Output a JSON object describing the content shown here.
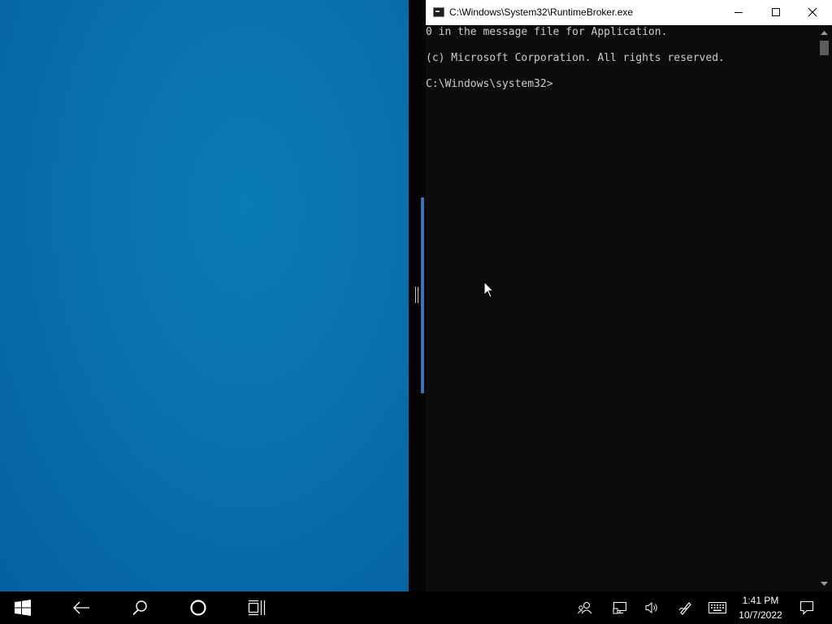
{
  "console": {
    "title": "C:\\Windows\\System32\\RuntimeBroker.exe",
    "icon": "cmd-console-icon",
    "lines": [
      "0 in the message file for Application.",
      "",
      "(c) Microsoft Corporation. All rights reserved.",
      "",
      "C:\\Windows\\system32>"
    ],
    "colors": {
      "background": "#0c0c0c",
      "text": "#cccccc"
    }
  },
  "taskbar": {
    "buttons": [
      "start-icon",
      "back-icon",
      "search-icon",
      "cortana-icon",
      "task-view-icon"
    ],
    "tray": [
      "people-icon",
      "network-icon",
      "volume-icon",
      "pen-icon",
      "touch-keyboard-icon",
      "action-center-icon"
    ],
    "clock": {
      "time": "1:41 PM",
      "date": "10/7/2022"
    }
  },
  "desktop": {
    "accent": "#0a72ae",
    "snap_bar_color": "#3e72b8"
  }
}
